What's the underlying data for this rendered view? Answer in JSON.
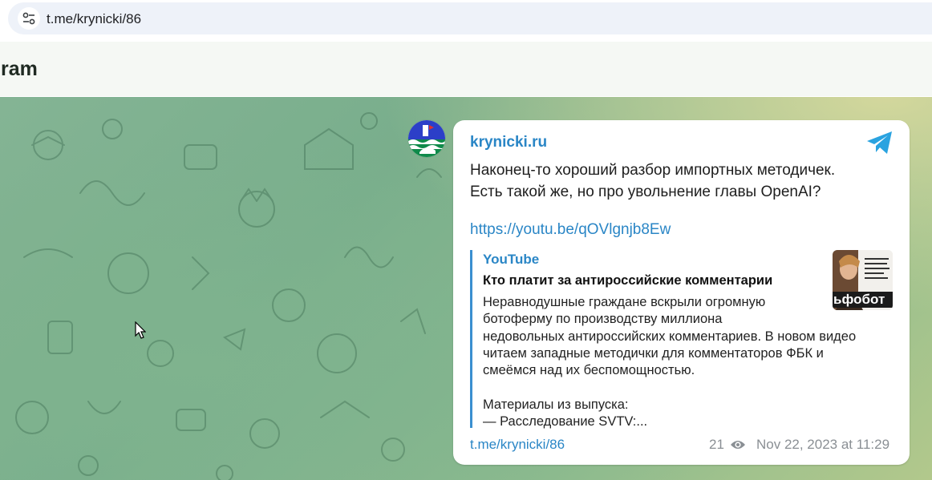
{
  "browser": {
    "url": "t.me/krynicki/86",
    "site_info_icon": "tune-icon"
  },
  "header": {
    "brand_visible": "ram"
  },
  "avatar": {
    "icon": "channel-avatar"
  },
  "message": {
    "channel_name": "krynicki.ru",
    "text_line1": "Наконец-то хороший разбор импортных методичек.",
    "text_line2": "Есть такой же, но про увольнение главы OpenAI?",
    "link": "https://youtu.be/qOVlgnjb8Ew",
    "preview": {
      "site": "YouTube",
      "title": "Кто платит за антироссийские комментарии",
      "description": "Неравнодушные граждане вскрыли огромную\nботоферму по производству миллиона\nнедовольных антироссийских комментариев. В новом видео\nчитаем западные методички для комментаторов ФБК и\nсмеёмся над их беспомощностью.\n\nМатериалы из выпуска:\n— Расследование SVTV:...",
      "thumbnail_caption": "ьфобот"
    },
    "footer_link": "t.me/krynicki/86",
    "views": "21",
    "date": "Nov 22, 2023 at 11:29"
  },
  "colors": {
    "link": "#2a86c6",
    "telegram": "#2aa3e0",
    "meta": "#8a8f94"
  }
}
